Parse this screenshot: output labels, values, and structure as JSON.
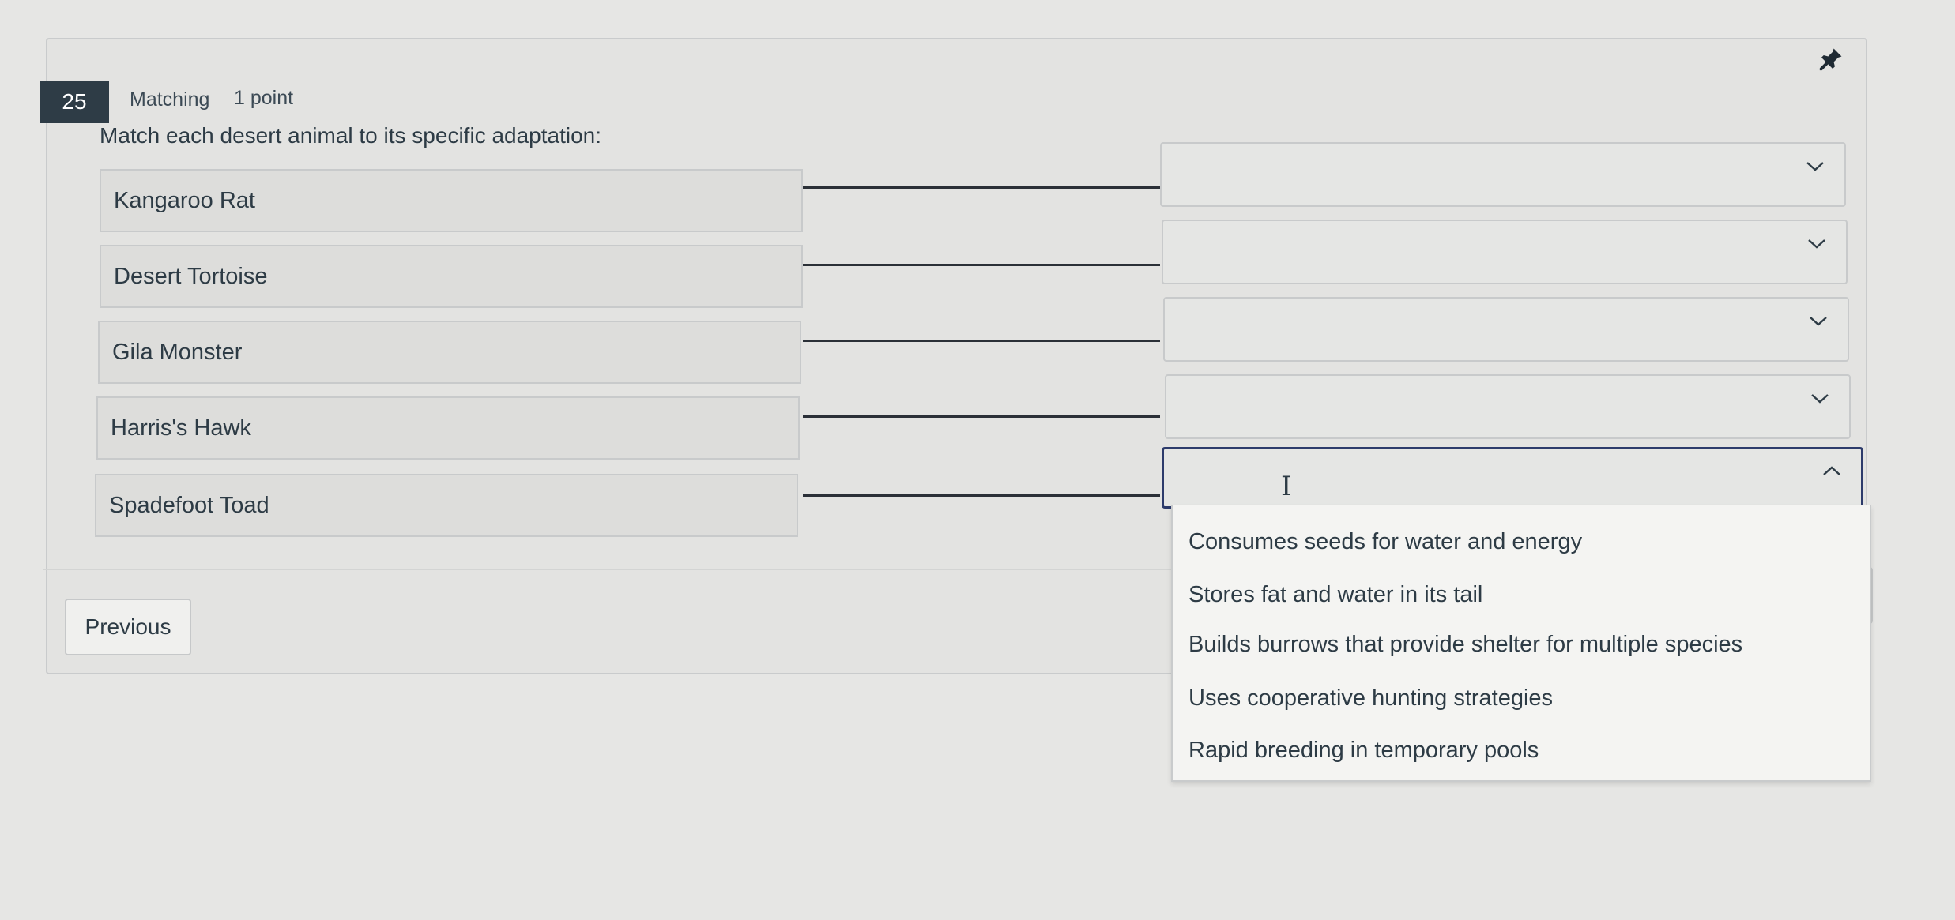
{
  "question": {
    "number": "25",
    "type": "Matching",
    "points": "1 point",
    "prompt": "Match each desert animal to its specific adaptation:"
  },
  "premises": [
    {
      "label": "Kangaroo Rat",
      "selected": ""
    },
    {
      "label": "Desert Tortoise",
      "selected": ""
    },
    {
      "label": "Gila Monster",
      "selected": ""
    },
    {
      "label": "Harris's Hawk",
      "selected": ""
    },
    {
      "label": "Spadefoot Toad",
      "selected": ""
    }
  ],
  "dropdown": {
    "open_for": "Spadefoot Toad",
    "options": [
      "Consumes seeds for water and energy",
      "Stores fat and water in its tail",
      "Builds burrows that provide shelter for multiple species",
      "Uses cooperative hunting strategies",
      "Rapid breeding in temporary pools"
    ]
  },
  "navigation": {
    "previous_label": "Previous"
  },
  "icons": {
    "pin": "pin-icon",
    "closed_select": "chevron-down-icon",
    "open_select": "chevron-up-icon",
    "cursor": "text-cursor-icon"
  },
  "colors": {
    "question_badge": "#2e3c46",
    "focus_border": "#2d3b6b",
    "text": "#2d3b45"
  }
}
